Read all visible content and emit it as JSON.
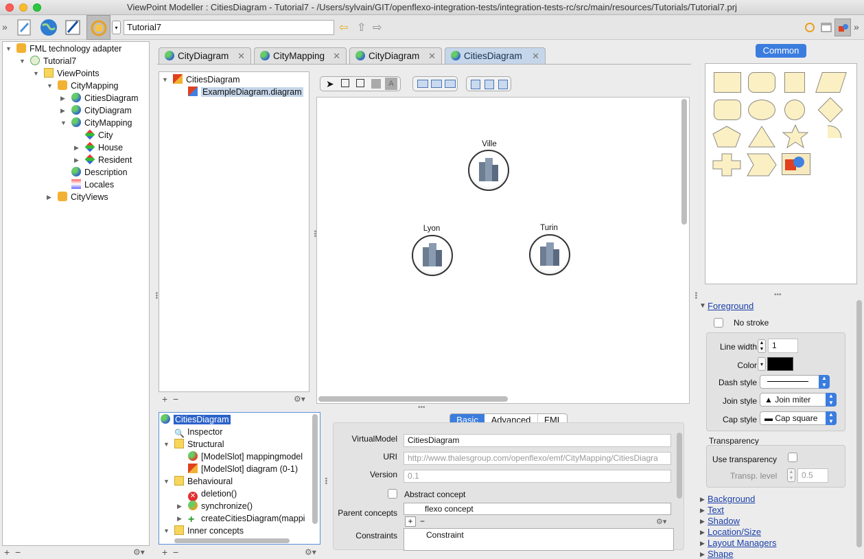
{
  "window": {
    "title": "ViewPoint Modeller : CitiesDiagram - Tutorial7 - /Users/sylvain/GIT/openflexo-integration-tests/integration-tests-rc/src/main/resources/Tutorials/Tutorial7.prj"
  },
  "toolbar": {
    "project": "Tutorial7"
  },
  "left_tree": {
    "root": "FML technology adapter",
    "items": [
      "Tutorial7",
      "ViewPoints",
      "CityMapping",
      "CitiesDiagram",
      "CityDiagram",
      "CityMapping",
      "City",
      "House",
      "Resident",
      "Description",
      "Locales",
      "CityViews"
    ]
  },
  "tabs": [
    "CityDiagram",
    "CityMapping",
    "CityDiagram",
    "CitiesDiagram"
  ],
  "diagram_tree": {
    "root": "CitiesDiagram",
    "child": "ExampleDiagram.diagram"
  },
  "canvas": {
    "nodes": [
      "Ville",
      "Lyon",
      "Turin"
    ]
  },
  "concept_tree": {
    "items": [
      "CitiesDiagram",
      "Inspector",
      "Structural",
      "[ModelSlot] mappingmodel",
      "[ModelSlot] diagram (0-1)",
      "Behavioural",
      "deletion()",
      "synchronize()",
      "createCitiesDiagram(mappi",
      "Inner concepts"
    ]
  },
  "inspector": {
    "tabs": [
      "Basic",
      "Advanced",
      "FML"
    ],
    "virtual_model_label": "VirtualModel",
    "virtual_model_value": "CitiesDiagram",
    "uri_label": "URI",
    "uri_value": "http://www.thalesgroup.com/openflexo/emf/CityMapping/CitiesDiagra",
    "version_label": "Version",
    "version_value": "0.1",
    "abstract_label": "Abstract concept",
    "parent_label": "Parent concepts",
    "parent_header": "flexo concept",
    "constraints_label": "Constraints",
    "constraints_header": "Constraint"
  },
  "palette": {
    "tab": "Common"
  },
  "style": {
    "foreground": "Foreground",
    "no_stroke": "No stroke",
    "line_width_label": "Line width",
    "line_width": "1",
    "color_label": "Color",
    "dash_label": "Dash style",
    "join_label": "Join style",
    "join_value": "Join miter",
    "cap_label": "Cap style",
    "cap_value": "Cap square",
    "transparency": "Transparency",
    "use_transparency": "Use transparency",
    "transp_level_label": "Transp. level",
    "transp_level": "0.5",
    "sections": [
      "Background",
      "Text",
      "Shadow",
      "Location/Size",
      "Layout Managers",
      "Shape"
    ]
  }
}
